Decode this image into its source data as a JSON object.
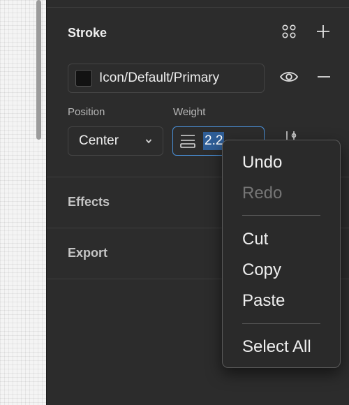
{
  "stroke": {
    "title": "Stroke",
    "fill": {
      "name": "Icon/Default/Primary",
      "color": "#121212"
    },
    "position_label": "Position",
    "position_value": "Center",
    "weight_label": "Weight",
    "weight_value": "2.2"
  },
  "sections": {
    "effects": "Effects",
    "export": "Export"
  },
  "context_menu": {
    "undo": "Undo",
    "redo": "Redo",
    "cut": "Cut",
    "copy": "Copy",
    "paste": "Paste",
    "select_all": "Select All"
  },
  "icons": {
    "styles": "four-dots-icon",
    "add": "plus-icon",
    "visibility": "eye-icon",
    "remove": "minus-icon",
    "weight": "stroke-weight-icon",
    "dropdown": "chevron-down-icon"
  },
  "colors": {
    "panel_bg": "#2c2c2c",
    "focus_border": "#4a8fd6",
    "selection": "#2f5e97"
  }
}
